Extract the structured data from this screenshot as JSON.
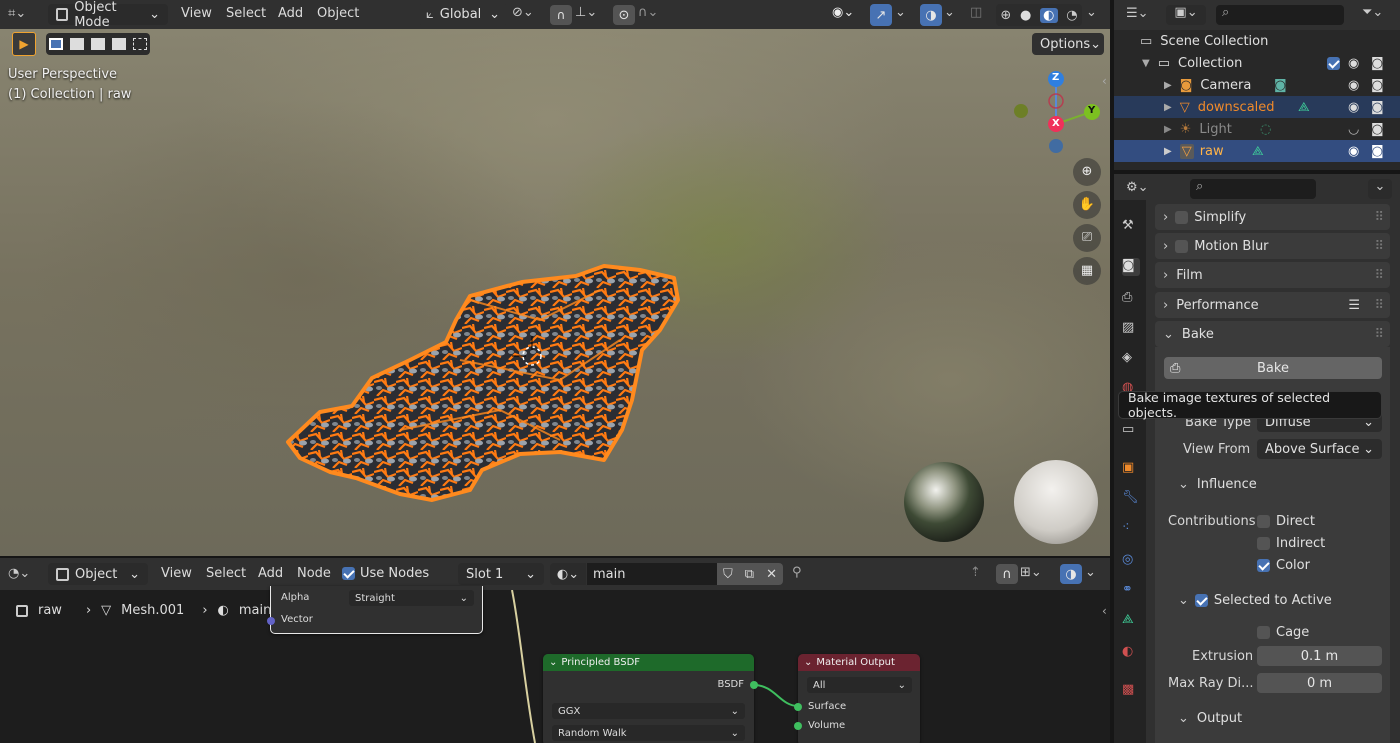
{
  "viewport": {
    "header": {
      "mode": "Object Mode",
      "menu": [
        "View",
        "Select",
        "Add",
        "Object"
      ],
      "transform_orientation": "Global",
      "options": "Options"
    },
    "overlay": {
      "perspective": "User Perspective",
      "collection": "(1) Collection | raw"
    },
    "gizmo_axes": {
      "z": "Z",
      "y": "Y",
      "x": "X"
    }
  },
  "node_editor": {
    "header": {
      "mode": "Object",
      "menu": [
        "View",
        "Select",
        "Add",
        "Node"
      ],
      "use_nodes": "Use Nodes",
      "slot": "Slot 1",
      "material": "main"
    },
    "breadcrumb": [
      "raw",
      "Mesh.001",
      "main"
    ],
    "image_node": {
      "alpha_label": "Alpha",
      "alpha_value": "Straight",
      "vector": "Vector"
    },
    "bsdf_node": {
      "title": "Principled BSDF",
      "output": "BSDF",
      "distribution": "GGX",
      "subsurface": "Random Walk"
    },
    "output_node": {
      "title": "Material Output",
      "target": "All",
      "surface": "Surface",
      "volume": "Volume"
    }
  },
  "outliner": {
    "scene": "Scene Collection",
    "collection": "Collection",
    "items": [
      {
        "name": "Camera"
      },
      {
        "name": "downscaled"
      },
      {
        "name": "Light"
      },
      {
        "name": "raw"
      }
    ]
  },
  "properties": {
    "panels": {
      "simplify": "Simplify",
      "motion_blur": "Motion Blur",
      "film": "Film",
      "performance": "Performance",
      "bake": "Bake"
    },
    "bake_button": "Bake",
    "tooltip": "Bake image textures of selected objects.",
    "bake_type_label": "Bake Type",
    "bake_type_value": "Diffuse",
    "view_from_label": "View From",
    "view_from_value": "Above Surface",
    "influence": "Influence",
    "contributions": "Contributions",
    "direct": "Direct",
    "indirect": "Indirect",
    "color": "Color",
    "selected_to_active": "Selected to Active",
    "cage": "Cage",
    "extrusion_label": "Extrusion",
    "extrusion_value": "0.1 m",
    "max_ray_label": "Max Ray Di...",
    "max_ray_value": "0 m",
    "output": "Output"
  },
  "colors": {
    "accent": "#4772b3",
    "selection_orange": "#f07a1a",
    "header": "#303030",
    "active_row": "#334d80"
  }
}
